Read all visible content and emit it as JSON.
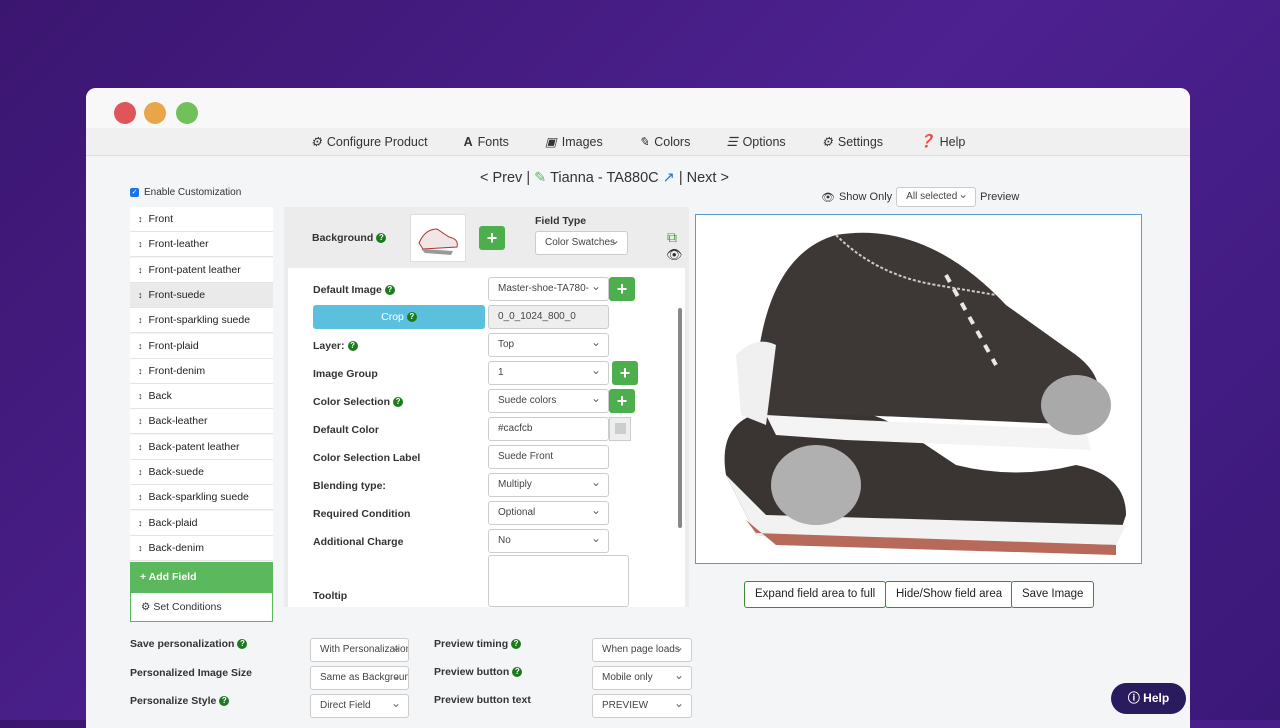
{
  "menu": [
    "Configure Product",
    "Fonts",
    "Images",
    "Colors",
    "Options",
    "Settings",
    "Help"
  ],
  "nav": {
    "prev": "< Prev |",
    "title": "Tianna - TA880C",
    "next": "| Next >"
  },
  "enable_customization": "Enable Customization",
  "fields": [
    "Front",
    "Front-leather",
    "Front-patent leather",
    "Front-suede",
    "Front-sparkling suede",
    "Front-plaid",
    "Front-denim",
    "Back",
    "Back-leather",
    "Back-patent leather",
    "Back-suede",
    "Back-sparkling suede",
    "Back-plaid",
    "Back-denim"
  ],
  "add_field": "+ Add Field",
  "set_conditions": "Set Conditions",
  "panel": {
    "background": "Background",
    "field_type_label": "Field Type",
    "field_type": "Color Swatches",
    "default_image_label": "Default Image",
    "default_image": "Master-shoe-TA780-",
    "crop": "Crop",
    "crop_value": "0_0_1024_800_0",
    "layer_label": "Layer:",
    "layer": "Top",
    "image_group_label": "Image Group",
    "image_group": "1",
    "color_selection_label": "Color Selection",
    "color_selection": "Suede colors",
    "default_color_label": "Default Color",
    "default_color": "#cacfcb",
    "color_sel_label_label": "Color Selection Label",
    "color_sel_label": "Suede Front",
    "blending_label": "Blending type:",
    "blending": "Multiply",
    "required_label": "Required Condition",
    "required": "Optional",
    "charge_label": "Additional Charge",
    "charge": "No",
    "tooltip_label": "Tooltip"
  },
  "preview": {
    "show_only": "Show Only",
    "show_only_value": "All selected",
    "preview": "Preview",
    "expand": "Expand field area to full",
    "hideshow": "Hide/Show field area",
    "save": "Save Image"
  },
  "settings": {
    "save_label": "Save personalization",
    "save": "With Personalization",
    "size_label": "Personalized Image Size",
    "size": "Same as Background",
    "style_label": "Personalize Style",
    "style": "Direct Field",
    "timing_label": "Preview timing",
    "timing": "When page loads",
    "button_label": "Preview button",
    "button": "Mobile only",
    "text_label": "Preview button text",
    "text": "PREVIEW"
  },
  "help": "Help"
}
